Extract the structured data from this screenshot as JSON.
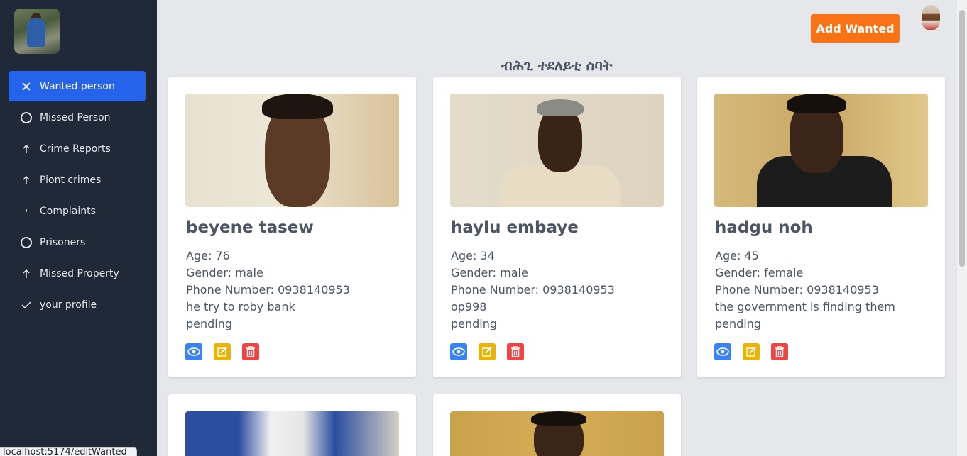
{
  "sidebar": {
    "items": [
      {
        "label": "Wanted person",
        "icon": "close-icon"
      },
      {
        "label": "Missed Person",
        "icon": "circle-icon"
      },
      {
        "label": "Crime Reports",
        "icon": "arrow-up-icon"
      },
      {
        "label": "Piont crimes",
        "icon": "arrow-up-icon"
      },
      {
        "label": "Complaints",
        "icon": "tick-mark-icon"
      },
      {
        "label": "Prisoners",
        "icon": "circle-icon"
      },
      {
        "label": "Missed Property",
        "icon": "arrow-up-icon"
      },
      {
        "label": "your profile",
        "icon": "check-icon"
      }
    ]
  },
  "header": {
    "add_button": "Add Wanted",
    "title": "ብሕጊ ተደለይቲ ሰባት"
  },
  "cards": [
    {
      "name": "beyene tasew",
      "age": "Age: 76",
      "gender": "Gender: male",
      "phone": "Phone Number: 0938140953",
      "description": "he try to roby bank",
      "status": "pending"
    },
    {
      "name": "haylu embaye",
      "age": "Age: 34",
      "gender": "Gender: male",
      "phone": "Phone Number: 0938140953",
      "description": "op998",
      "status": "pending"
    },
    {
      "name": "hadgu noh",
      "age": "Age: 45",
      "gender": "Gender: female",
      "phone": "Phone Number: 0938140953",
      "description": "the government is finding them",
      "status": "pending"
    }
  ],
  "status_url": "localhost:5174/editWanted",
  "colors": {
    "sidebar_bg": "#1f2937",
    "active_item": "#2563eb",
    "add_button": "#f97316",
    "view_icon": "#3b82f6",
    "edit_icon": "#eab308",
    "delete_icon": "#ef4444"
  }
}
